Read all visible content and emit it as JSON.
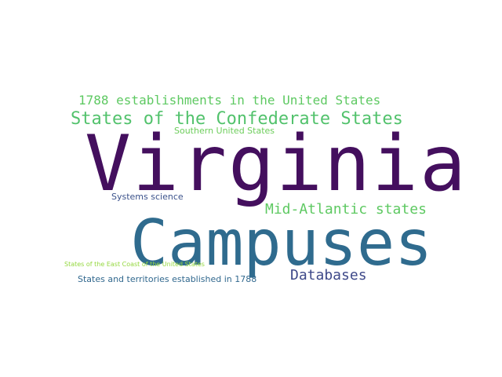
{
  "word_cloud": {
    "words": [
      {
        "text": "Virginia",
        "color": "#440f5e"
      },
      {
        "text": "Campuses",
        "color": "#2f6b8e"
      },
      {
        "text": "States of the Confederate States",
        "color": "#52c26c"
      },
      {
        "text": "1788 establishments in the United States",
        "color": "#5ec962"
      },
      {
        "text": "Southern United States",
        "color": "#6ccd5a"
      },
      {
        "text": "Systems science",
        "color": "#3b528b"
      },
      {
        "text": "Mid-Atlantic states",
        "color": "#5ec962"
      },
      {
        "text": "Databases",
        "color": "#3e4989"
      },
      {
        "text": "States of the East Coast of the United States",
        "color": "#95d840"
      },
      {
        "text": "States and territories established in 1788",
        "color": "#31688e"
      }
    ]
  }
}
